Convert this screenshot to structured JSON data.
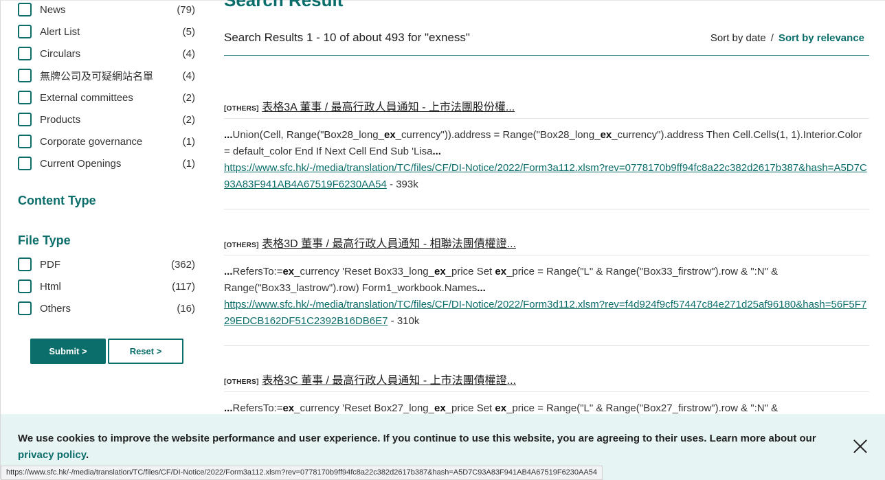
{
  "main": {
    "title": "Search Result",
    "summary": "Search Results 1 - 10 of about 493 for \"exness\"",
    "sort": {
      "by_date": "Sort by date",
      "separator": "/",
      "by_relevance": "Sort by relevance"
    }
  },
  "sidebar": {
    "category_filters": [
      {
        "label": "News",
        "count": "(79)"
      },
      {
        "label": "Alert List",
        "count": "(5)"
      },
      {
        "label": "Circulars",
        "count": "(4)"
      },
      {
        "label": "無牌公司及可疑網站名單",
        "count": "(4)"
      },
      {
        "label": "External committees",
        "count": "(2)"
      },
      {
        "label": "Products",
        "count": "(2)"
      },
      {
        "label": "Corporate governance",
        "count": "(1)"
      },
      {
        "label": "Current Openings",
        "count": "(1)"
      }
    ],
    "content_type_heading": "Content Type",
    "file_type_heading": "File Type",
    "file_type_filters": [
      {
        "label": "PDF",
        "count": "(362)"
      },
      {
        "label": "Html",
        "count": "(117)"
      },
      {
        "label": "Others",
        "count": "(16)"
      }
    ],
    "submit_label": "Submit >",
    "reset_label": "Reset >"
  },
  "results": [
    {
      "tag": "[OTHERS]",
      "title": "表格3A 董事 / 最高行政人員通知 - 上市法團股份權...",
      "snippet_html": "<b>...</b>Union(Cell, Range(\"Box28_long_<b>ex</b>_currency\")).address = Range(\"Box28_long_<b>ex</b>_currency\").address Then Cell.Cells(1, 1).Interior.Color = default_color End If Next Cell End Sub 'Lisa<b>...</b>",
      "url": "https://www.sfc.hk/-/media/translation/TC/files/CF/DI-Notice/2022/Form3a112.xlsm?rev=0778170b9ff94fc8a22c382d2617b387&hash=A5D7C93A83F941AB4A67519F6230AA54",
      "size": " - 393k"
    },
    {
      "tag": "[OTHERS]",
      "title": "表格3D 董事 / 最高行政人員通知 - 相聯法團債權證...",
      "snippet_html": "<b>...</b>RefersTo:=<b>ex</b>_currency 'Reset Box33_long_<b>ex</b>_price Set <b>ex</b>_price = Range(\"L\" & Range(\"Box33_firstrow\").row & \":N\" & Range(\"Box33_lastrow\").row) Form1_workbook.Names<b>...</b>",
      "url": "https://www.sfc.hk/-/media/translation/TC/files/CF/DI-Notice/2022/Form3d112.xlsm?rev=f4d924f9cf57447c84e271d25af96180&hash=56F5F729EDCB162DF51C2392B16DB6E7",
      "size": " - 310k"
    },
    {
      "tag": "[OTHERS]",
      "title": "表格3C 董事 / 最高行政人員通知 - 上市法團債權證...",
      "snippet_html": "<b>...</b>RefersTo:=<b>ex</b>_currency 'Reset Box27_long_<b>ex</b>_price Set <b>ex</b>_price = Range(\"L\" & Range(\"Box27_firstrow\").row & \":N\" &",
      "url": "",
      "size": ""
    }
  ],
  "cookie": {
    "text": "We use cookies to improve the website performance and user experience. If you continue to use this website, you are agreeing to their uses. Learn more about our ",
    "link": "privacy policy",
    "end": "."
  },
  "status_bar_url": "https://www.sfc.hk/-/media/translation/TC/files/CF/DI-Notice/2022/Form3a112.xlsm?rev=0778170b9ff94fc8a22c382d2617b387&hash=A5D7C93A83F941AB4A67519F6230AA54",
  "colors": {
    "accent": "#0b6e6a",
    "cookie_bg": "#e7f4f4"
  }
}
